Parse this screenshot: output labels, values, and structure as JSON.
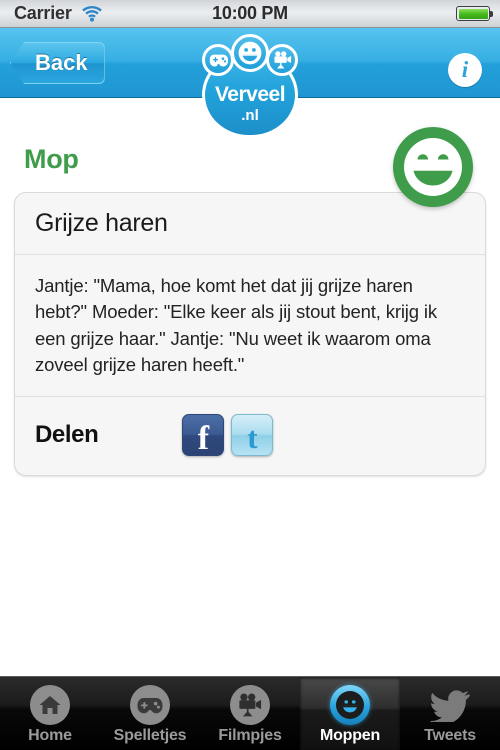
{
  "statusbar": {
    "carrier": "Carrier",
    "time": "10:00 PM",
    "wifi_icon": "wifi-icon",
    "battery_icon": "battery-icon"
  },
  "navbar": {
    "back_label": "Back",
    "info_label": "i",
    "logo": {
      "word": "Verveel",
      "tld": ".nl",
      "bubbles": [
        "gamepad-icon",
        "smiley-icon",
        "film-camera-icon"
      ]
    }
  },
  "main": {
    "page_title": "Mop",
    "mood_icon": "green-smiley-icon",
    "card": {
      "title": "Grijze haren",
      "joke": "Jantje: \"Mama, hoe komt het dat jij grijze haren hebt?\" Moeder: \"Elke keer als jij stout bent, krijg ik een grijze haar.\" Jantje: \"Nu weet ik waarom oma zoveel grijze haren heeft.\"",
      "share_label": "Delen",
      "share_buttons": [
        {
          "name": "facebook-share-button",
          "glyph": "f"
        },
        {
          "name": "twitter-share-button",
          "glyph": "t"
        }
      ]
    }
  },
  "tabbar": {
    "items": [
      {
        "label": "Home",
        "icon": "home-icon",
        "active": false
      },
      {
        "label": "Spelletjes",
        "icon": "gamepad-icon",
        "active": false
      },
      {
        "label": "Filmpjes",
        "icon": "film-camera-icon",
        "active": false
      },
      {
        "label": "Moppen",
        "icon": "smiley-icon",
        "active": true
      },
      {
        "label": "Tweets",
        "icon": "twitter-bird-icon",
        "active": false
      }
    ]
  },
  "colors": {
    "nav_blue": "#23a0da",
    "accent_green": "#3e9c4a",
    "facebook_blue": "#3c5a92",
    "twitter_blue": "#2a9ad0",
    "tab_active_blue": "#29a3e0"
  }
}
